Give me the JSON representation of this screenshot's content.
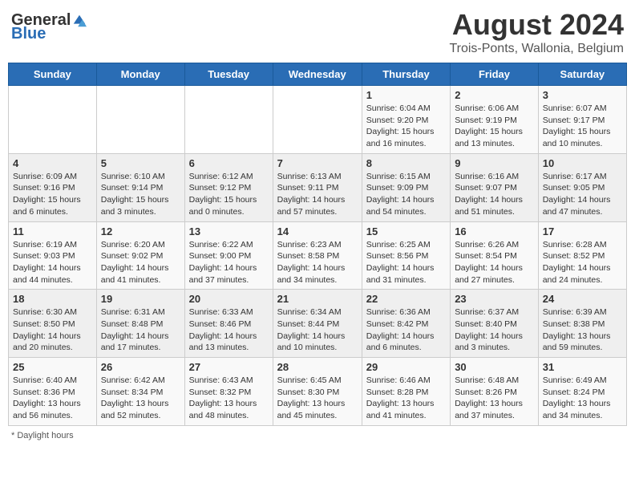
{
  "logo": {
    "general": "General",
    "blue": "Blue"
  },
  "title": "August 2024",
  "subtitle": "Trois-Ponts, Wallonia, Belgium",
  "days_of_week": [
    "Sunday",
    "Monday",
    "Tuesday",
    "Wednesday",
    "Thursday",
    "Friday",
    "Saturday"
  ],
  "weeks": [
    [
      {
        "day": "",
        "info": ""
      },
      {
        "day": "",
        "info": ""
      },
      {
        "day": "",
        "info": ""
      },
      {
        "day": "",
        "info": ""
      },
      {
        "day": "1",
        "info": "Sunrise: 6:04 AM\nSunset: 9:20 PM\nDaylight: 15 hours and 16 minutes."
      },
      {
        "day": "2",
        "info": "Sunrise: 6:06 AM\nSunset: 9:19 PM\nDaylight: 15 hours and 13 minutes."
      },
      {
        "day": "3",
        "info": "Sunrise: 6:07 AM\nSunset: 9:17 PM\nDaylight: 15 hours and 10 minutes."
      }
    ],
    [
      {
        "day": "4",
        "info": "Sunrise: 6:09 AM\nSunset: 9:16 PM\nDaylight: 15 hours and 6 minutes."
      },
      {
        "day": "5",
        "info": "Sunrise: 6:10 AM\nSunset: 9:14 PM\nDaylight: 15 hours and 3 minutes."
      },
      {
        "day": "6",
        "info": "Sunrise: 6:12 AM\nSunset: 9:12 PM\nDaylight: 15 hours and 0 minutes."
      },
      {
        "day": "7",
        "info": "Sunrise: 6:13 AM\nSunset: 9:11 PM\nDaylight: 14 hours and 57 minutes."
      },
      {
        "day": "8",
        "info": "Sunrise: 6:15 AM\nSunset: 9:09 PM\nDaylight: 14 hours and 54 minutes."
      },
      {
        "day": "9",
        "info": "Sunrise: 6:16 AM\nSunset: 9:07 PM\nDaylight: 14 hours and 51 minutes."
      },
      {
        "day": "10",
        "info": "Sunrise: 6:17 AM\nSunset: 9:05 PM\nDaylight: 14 hours and 47 minutes."
      }
    ],
    [
      {
        "day": "11",
        "info": "Sunrise: 6:19 AM\nSunset: 9:03 PM\nDaylight: 14 hours and 44 minutes."
      },
      {
        "day": "12",
        "info": "Sunrise: 6:20 AM\nSunset: 9:02 PM\nDaylight: 14 hours and 41 minutes."
      },
      {
        "day": "13",
        "info": "Sunrise: 6:22 AM\nSunset: 9:00 PM\nDaylight: 14 hours and 37 minutes."
      },
      {
        "day": "14",
        "info": "Sunrise: 6:23 AM\nSunset: 8:58 PM\nDaylight: 14 hours and 34 minutes."
      },
      {
        "day": "15",
        "info": "Sunrise: 6:25 AM\nSunset: 8:56 PM\nDaylight: 14 hours and 31 minutes."
      },
      {
        "day": "16",
        "info": "Sunrise: 6:26 AM\nSunset: 8:54 PM\nDaylight: 14 hours and 27 minutes."
      },
      {
        "day": "17",
        "info": "Sunrise: 6:28 AM\nSunset: 8:52 PM\nDaylight: 14 hours and 24 minutes."
      }
    ],
    [
      {
        "day": "18",
        "info": "Sunrise: 6:30 AM\nSunset: 8:50 PM\nDaylight: 14 hours and 20 minutes."
      },
      {
        "day": "19",
        "info": "Sunrise: 6:31 AM\nSunset: 8:48 PM\nDaylight: 14 hours and 17 minutes."
      },
      {
        "day": "20",
        "info": "Sunrise: 6:33 AM\nSunset: 8:46 PM\nDaylight: 14 hours and 13 minutes."
      },
      {
        "day": "21",
        "info": "Sunrise: 6:34 AM\nSunset: 8:44 PM\nDaylight: 14 hours and 10 minutes."
      },
      {
        "day": "22",
        "info": "Sunrise: 6:36 AM\nSunset: 8:42 PM\nDaylight: 14 hours and 6 minutes."
      },
      {
        "day": "23",
        "info": "Sunrise: 6:37 AM\nSunset: 8:40 PM\nDaylight: 14 hours and 3 minutes."
      },
      {
        "day": "24",
        "info": "Sunrise: 6:39 AM\nSunset: 8:38 PM\nDaylight: 13 hours and 59 minutes."
      }
    ],
    [
      {
        "day": "25",
        "info": "Sunrise: 6:40 AM\nSunset: 8:36 PM\nDaylight: 13 hours and 56 minutes."
      },
      {
        "day": "26",
        "info": "Sunrise: 6:42 AM\nSunset: 8:34 PM\nDaylight: 13 hours and 52 minutes."
      },
      {
        "day": "27",
        "info": "Sunrise: 6:43 AM\nSunset: 8:32 PM\nDaylight: 13 hours and 48 minutes."
      },
      {
        "day": "28",
        "info": "Sunrise: 6:45 AM\nSunset: 8:30 PM\nDaylight: 13 hours and 45 minutes."
      },
      {
        "day": "29",
        "info": "Sunrise: 6:46 AM\nSunset: 8:28 PM\nDaylight: 13 hours and 41 minutes."
      },
      {
        "day": "30",
        "info": "Sunrise: 6:48 AM\nSunset: 8:26 PM\nDaylight: 13 hours and 37 minutes."
      },
      {
        "day": "31",
        "info": "Sunrise: 6:49 AM\nSunset: 8:24 PM\nDaylight: 13 hours and 34 minutes."
      }
    ]
  ],
  "footer": "Daylight hours"
}
